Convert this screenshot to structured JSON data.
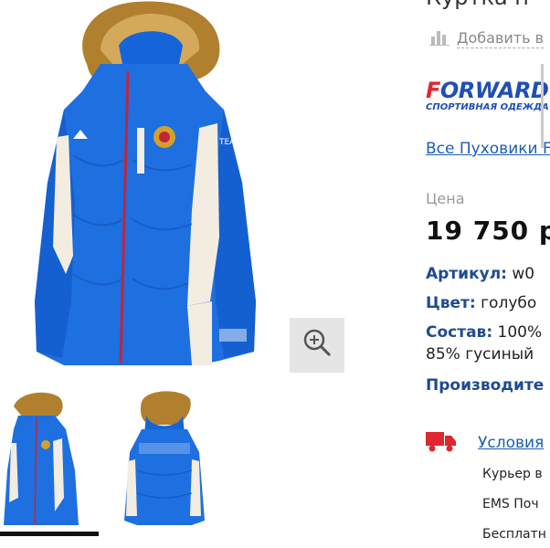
{
  "product": {
    "title": "Куртка п",
    "compare_label": "Добавить в",
    "brand": {
      "name_first": "F",
      "name_rest": "ORWARD",
      "tagline": "СПОРТИВНАЯ ОДЕЖДА"
    },
    "category_link": "Все Пуховики F",
    "price_label": "Цена",
    "price": "19 750 р",
    "props": {
      "article_key": "Артикул:",
      "article_val": " w0",
      "color_key": "Цвет:",
      "color_val": " голубо",
      "composition_key": "Состав:",
      "composition_val": " 100%",
      "composition_line2": "85% гусиный",
      "maker_key": "Производите"
    },
    "delivery": {
      "link": "Условия",
      "options": [
        "Курьер в",
        "EMS Поч",
        "Бесплатн"
      ]
    }
  },
  "colors": {
    "accent_blue": "#1f4fb5",
    "link_blue": "#1a5fb4",
    "delivery_red": "#e0262e"
  },
  "icons": {
    "zoom": "magnifier-plus-icon",
    "compare": "bar-chart-icon",
    "delivery": "truck-icon"
  }
}
